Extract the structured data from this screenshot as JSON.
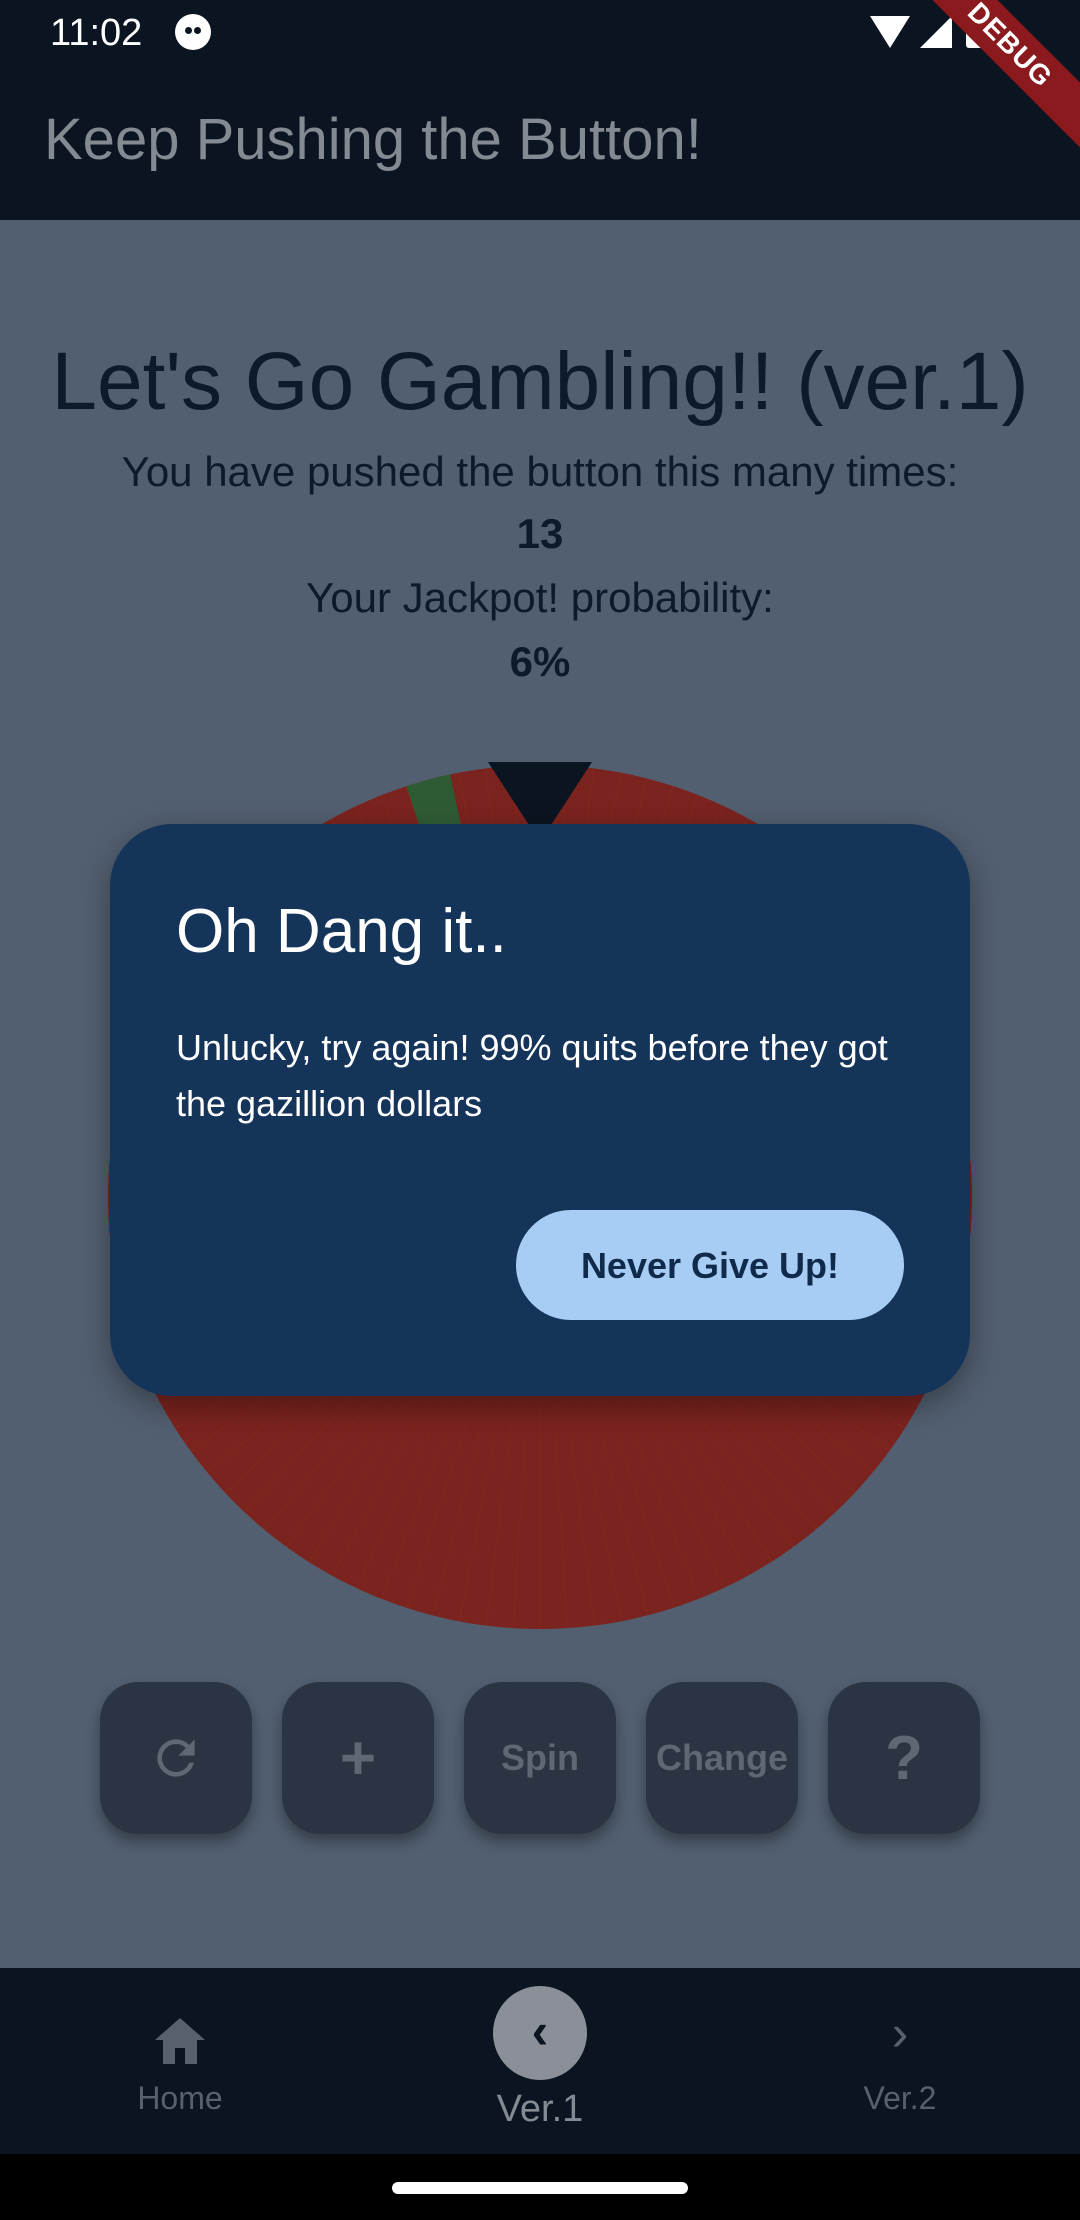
{
  "status_bar": {
    "time": "11:02"
  },
  "debug_banner": "DEBUG",
  "app_bar": {
    "title": "Keep Pushing the Button!"
  },
  "main": {
    "heading": "Let's Go Gambling!! (ver.1)",
    "count_label": "You have pushed the button this many times:",
    "count_value": "13",
    "probability_label": "Your Jackpot! probability:",
    "probability_value": "6%"
  },
  "wheel": {
    "segment_colors": [
      "#7b231e",
      "#2f5b34"
    ]
  },
  "controls": {
    "reset_icon": "refresh-icon",
    "add_icon": "plus-icon",
    "spin_label": "Spin",
    "change_label": "Change",
    "help_label": "?"
  },
  "dialog": {
    "title": "Oh Dang it..",
    "message": "Unlucky, try again! 99% quits before they got the gazillion dollars",
    "button_label": "Never Give Up!"
  },
  "bottom_nav": {
    "items": [
      {
        "label": "Home",
        "icon": "home-icon"
      },
      {
        "label": "Ver.1",
        "icon": "chevron-left-icon",
        "active": true
      },
      {
        "label": "Ver.2",
        "icon": "chevron-right-icon"
      }
    ]
  },
  "colors": {
    "app_bar": "#0a1521",
    "scrim_background": "#525f70",
    "dialog": "#15345a",
    "dialog_button": "#a8cdf4",
    "wheel_red": "#7b231e",
    "wheel_green": "#2f5b34"
  }
}
